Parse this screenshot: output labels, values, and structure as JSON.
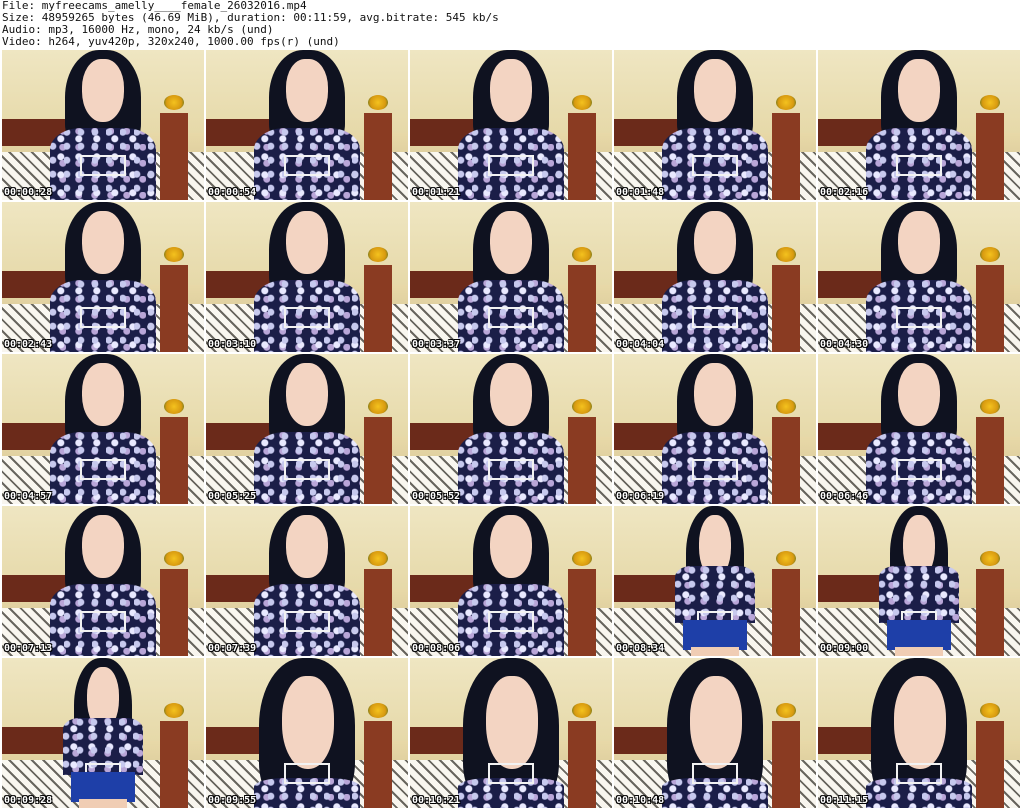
{
  "header": {
    "file_line": "File: myfreecams_amelly____female_26032016.mp4",
    "size_line": "Size: 48959265 bytes (46.69 MiB), duration: 00:11:59, avg.bitrate: 545 kb/s",
    "audio_line": "Audio: mp3, 16000 Hz, mono, 24 kb/s (und)",
    "video_line": "Video: h264, yuv420p, 320x240, 1000.00 fps(r) (und)"
  },
  "thumbnails": [
    {
      "timestamp": "00:00:28",
      "scene": "seated"
    },
    {
      "timestamp": "00:00:54",
      "scene": "seated"
    },
    {
      "timestamp": "00:01:21",
      "scene": "seated"
    },
    {
      "timestamp": "00:01:48",
      "scene": "seated"
    },
    {
      "timestamp": "00:02:16",
      "scene": "seated"
    },
    {
      "timestamp": "00:02:43",
      "scene": "seated"
    },
    {
      "timestamp": "00:03:10",
      "scene": "seated"
    },
    {
      "timestamp": "00:03:37",
      "scene": "seated"
    },
    {
      "timestamp": "00:04:04",
      "scene": "seated"
    },
    {
      "timestamp": "00:04:30",
      "scene": "seated"
    },
    {
      "timestamp": "00:04:57",
      "scene": "seated"
    },
    {
      "timestamp": "00:05:25",
      "scene": "seated"
    },
    {
      "timestamp": "00:05:52",
      "scene": "seated"
    },
    {
      "timestamp": "00:06:19",
      "scene": "seated"
    },
    {
      "timestamp": "00:06:46",
      "scene": "seated"
    },
    {
      "timestamp": "00:07:13",
      "scene": "seated"
    },
    {
      "timestamp": "00:07:39",
      "scene": "seated"
    },
    {
      "timestamp": "00:08:06",
      "scene": "seated"
    },
    {
      "timestamp": "00:08:34",
      "scene": "standing"
    },
    {
      "timestamp": "00:09:00",
      "scene": "standing"
    },
    {
      "timestamp": "00:09:28",
      "scene": "standing"
    },
    {
      "timestamp": "00:09:55",
      "scene": "close"
    },
    {
      "timestamp": "00:10:21",
      "scene": "close"
    },
    {
      "timestamp": "00:10:48",
      "scene": "close"
    },
    {
      "timestamp": "00:11:15",
      "scene": "close"
    }
  ]
}
